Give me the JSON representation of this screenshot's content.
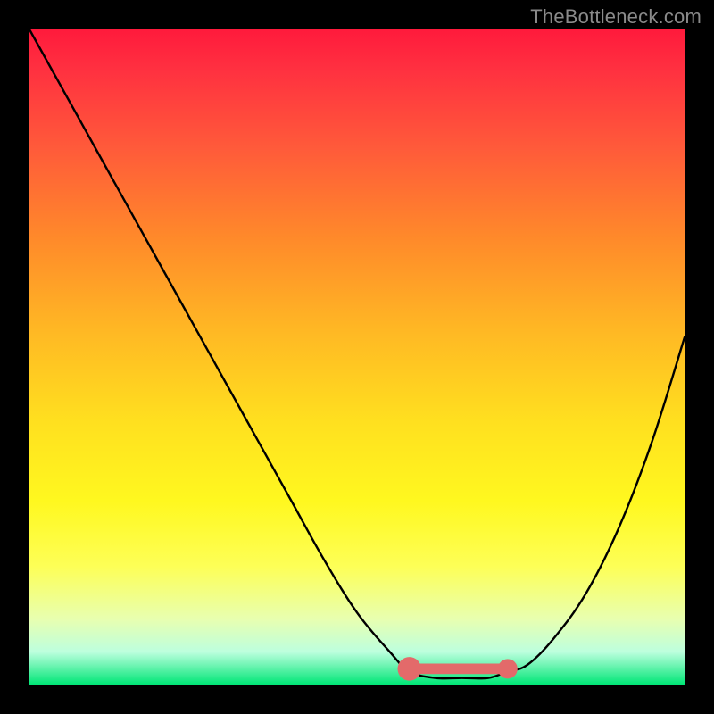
{
  "watermark": "TheBottleneck.com",
  "chart_data": {
    "type": "line",
    "title": "",
    "xlabel": "",
    "ylabel": "",
    "xlim": [
      0,
      100
    ],
    "ylim": [
      0,
      100
    ],
    "series": [
      {
        "name": "curve",
        "x": [
          0,
          5,
          10,
          15,
          20,
          25,
          30,
          35,
          40,
          45,
          50,
          55,
          58,
          62,
          66,
          70,
          73,
          76,
          80,
          85,
          90,
          95,
          100
        ],
        "y": [
          100,
          91,
          82,
          73,
          64,
          55,
          46,
          37,
          28,
          19,
          11,
          5,
          2,
          1,
          1,
          1,
          2,
          3,
          7,
          14,
          24,
          37,
          53
        ]
      }
    ],
    "markers": [
      {
        "name": "trough-start",
        "x": 58,
        "y": 2.4,
        "r": 1.8
      },
      {
        "name": "trough-end",
        "x": 73,
        "y": 2.4,
        "r": 1.5
      }
    ],
    "trough_band": {
      "x0": 58,
      "x1": 73,
      "y": 2.4,
      "thickness": 1.6
    },
    "colors": {
      "curve": "#000000",
      "marker": "#e36a6a",
      "band": "#e36a6a"
    }
  }
}
